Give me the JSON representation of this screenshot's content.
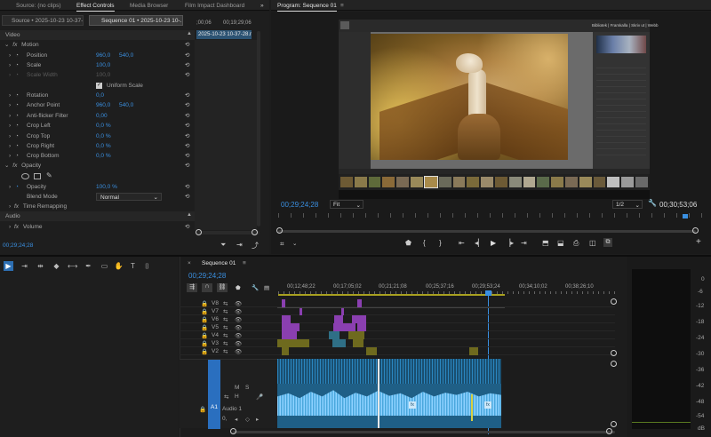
{
  "tabs_top_left": [
    "Source: (no clips)",
    "Effect Controls",
    "Media Browser",
    "Film Impact Dashboard"
  ],
  "ec": {
    "source_clip": "Source • 2025-10-23 10-37-2...",
    "sequence_clip": "Sequence 01 • 2025-10-23 10-...",
    "ruler_start": ";00;06",
    "ruler_end": "00;19;29;06",
    "clip_name": "2025-10-23 10-37-28.m",
    "video_label": "Video",
    "motion": "Motion",
    "position": "Position",
    "position_x": "960,0",
    "position_y": "540,0",
    "scale": "Scale",
    "scale_val": "100,0",
    "scale_width": "Scale Width",
    "scale_width_val": "100,0",
    "uniform_scale": "Uniform Scale",
    "rotation": "Rotation",
    "rotation_val": "0,0",
    "anchor": "Anchor Point",
    "anchor_x": "960,0",
    "anchor_y": "540,0",
    "anti_flicker": "Anti-flicker Filter",
    "anti_flicker_val": "0,00",
    "crop_left": "Crop Left",
    "crop_left_val": "0,0 %",
    "crop_top": "Crop Top",
    "crop_top_val": "0,0 %",
    "crop_right": "Crop Right",
    "crop_right_val": "0,0 %",
    "crop_bottom": "Crop Bottom",
    "crop_bottom_val": "0,0 %",
    "opacity_section": "Opacity",
    "opacity": "Opacity",
    "opacity_val": "100,0 %",
    "blend_mode": "Blend Mode",
    "blend_mode_val": "Normal",
    "time_remap": "Time Remapping",
    "audio_label": "Audio",
    "volume": "Volume",
    "timecode": "00;29;24;28"
  },
  "program": {
    "tab": "Program: Sequence 01",
    "timecode": "00;29;24;28",
    "fit": "Fit",
    "resolution": "1/2",
    "duration": "00;30;53;06"
  },
  "lightroom": {
    "modules": "Bibliotek | Framkalla | Skriv ut | Webb"
  },
  "timeline": {
    "tab": "Sequence 01",
    "timecode": "00;29;24;28",
    "ruler": [
      "00;12;48;22",
      "00;17;05;02",
      "00;21;21;08",
      "00;25;37;16",
      "00;29;53;24",
      "00;34;10;02",
      "00;38;26;10"
    ],
    "tracks": [
      "V8",
      "V7",
      "V6",
      "V5",
      "V4",
      "V3",
      "V2"
    ],
    "audio_track": "A1",
    "audio_name": "Audio 1",
    "audio_level": "0,",
    "m_btn": "M",
    "s_btn": "S",
    "h_btn": "H",
    "clip_fx": "fx"
  },
  "meter": {
    "scale": [
      "0",
      "-6",
      "-12",
      "-18",
      "-24",
      "-30",
      "-36",
      "-42",
      "-48",
      "-54",
      "dB"
    ]
  },
  "colors": {
    "accent": "#3a8fe0",
    "purple": "#8a3fb0",
    "olive": "#6e6a1e",
    "teal": "#2f6f86",
    "audio": "#2a86c0"
  }
}
